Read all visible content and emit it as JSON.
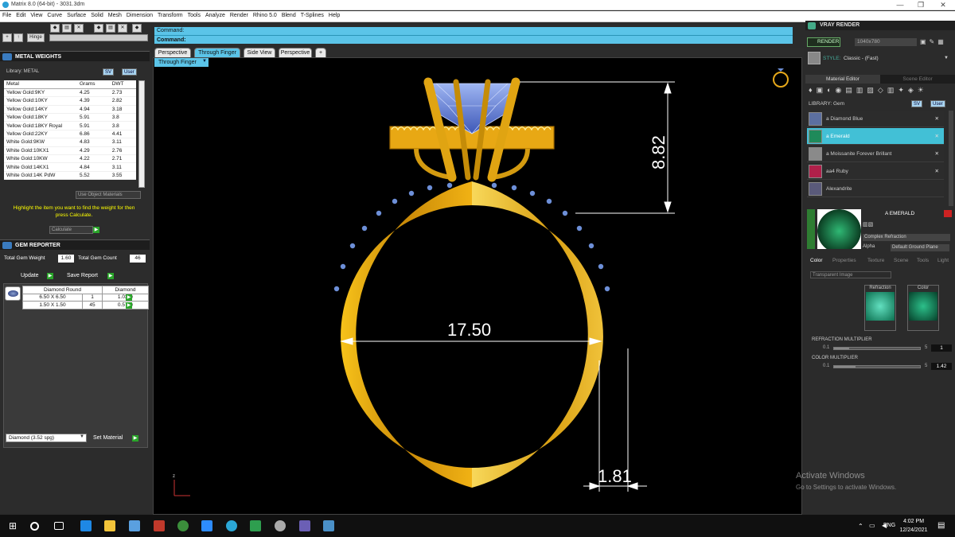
{
  "app": {
    "title": "Matrix 8.0 (64-bit) - 3031.3dm",
    "win_min": "—",
    "win_max": "❐",
    "win_close": "✕"
  },
  "menu": [
    "File",
    "Edit",
    "View",
    "Curve",
    "Surface",
    "Solid",
    "Mesh",
    "Dimension",
    "Transform",
    "Tools",
    "Analyze",
    "Render",
    "Rhino 5.0",
    "Blend",
    "T-Splines",
    "Help"
  ],
  "left_toolbar": {
    "hinge": "Hinge"
  },
  "metal_weights": {
    "title": "METAL WEIGHTS",
    "library_label": "Library: METAL",
    "sv": "SV",
    "user": "User",
    "headers": [
      "Metal",
      "Grams",
      "DWT"
    ],
    "rows": [
      [
        "Yellow Gold:9KY",
        "4.25",
        "2.73"
      ],
      [
        "Yellow Gold:10KY",
        "4.39",
        "2.82"
      ],
      [
        "Yellow Gold:14KY",
        "4.94",
        "3.18"
      ],
      [
        "Yellow Gold:18KY",
        "5.91",
        "3.8"
      ],
      [
        "Yellow Gold:18KY Royal",
        "5.91",
        "3.8"
      ],
      [
        "Yellow Gold:22KY",
        "6.86",
        "4.41"
      ],
      [
        "White Gold:9KW",
        "4.83",
        "3.11"
      ],
      [
        "White Gold:10KX1",
        "4.29",
        "2.76"
      ],
      [
        "White Gold:10KW",
        "4.22",
        "2.71"
      ],
      [
        "White Gold:14KX1",
        "4.84",
        "3.11"
      ],
      [
        "White Gold:14K PdW",
        "5.52",
        "3.55"
      ]
    ],
    "use_object_materials": "Use Object Materials",
    "hint": "Highlight the item you want to find the weight for then press Calculate.",
    "calculate": "Calculate"
  },
  "gem_reporter": {
    "title": "GEM REPORTER",
    "total_weight_label": "Total Gem Weight",
    "total_weight": "1.60",
    "total_count_label": "Total Gem Count",
    "total_count": "46",
    "update": "Update",
    "save_report": "Save Report",
    "headers": [
      "Diamond Round",
      "Diamond"
    ],
    "rows": [
      [
        "6.50 X 6.50",
        "1",
        "1.03tw"
      ],
      [
        "1.50 X 1.50",
        "45",
        "0.57tw"
      ]
    ],
    "material_select": "Diamond   (3.52 spg)",
    "set_material": "Set Material"
  },
  "command": {
    "line1": "Command:",
    "line2": "Command:"
  },
  "tabs": [
    "Perspective",
    "Through Finger",
    "Side View",
    "Perspective",
    "+"
  ],
  "viewport": {
    "label": "Through Finger",
    "dims": {
      "height": "8.82",
      "inner": "17.50",
      "thickness": "1.81"
    },
    "axis_z": "z"
  },
  "vray": {
    "title": "VRAY RENDER",
    "render": "RENDER",
    "resolution": "1040x780",
    "style_label": "STYLE:",
    "style": "Classic - (Fast)",
    "tabs": [
      "Material Editor",
      "Scene Editor"
    ],
    "library": "LIBRARY: Gem",
    "sv": "SV",
    "user": "User",
    "materials": [
      {
        "name": "a Diamond Blue",
        "color": "#5c6fa0"
      },
      {
        "name": "a Emerald",
        "color": "#1f8a5a"
      },
      {
        "name": "a Moissanite Forever Brillant",
        "color": "#8a8a8a"
      },
      {
        "name": "aa4 Ruby",
        "color": "#b0204a"
      },
      {
        "name": "Alexandrite",
        "color": "#5a5a7a"
      }
    ],
    "selected": "A EMERALD",
    "complex": "Complex Refraction",
    "alpha": "Alpha",
    "ground": "Default Ground Plane",
    "subtabs": [
      "Color",
      "Properties",
      "Texture",
      "Scene",
      "Tools",
      "Light"
    ],
    "transparent": "Transparent Image",
    "refraction": "Refraction",
    "color": "Color",
    "refraction_mult_label": "REFRACTION MULTIPLIER",
    "refraction_min": "0.1",
    "refraction_max": "5",
    "refraction_val": "1",
    "color_mult_label": "COLOR MULTIPLIER",
    "color_min": "0.1",
    "color_max": "5",
    "color_val": "1.42",
    "refraction_level": 0.18,
    "color_level": 0.25
  },
  "activate": {
    "line1": "Activate Windows",
    "line2": "Go to Settings to activate Windows."
  },
  "taskbar": {
    "lang": "ENG",
    "time": "4:02 PM",
    "date": "12/24/2021"
  },
  "colors": {
    "accent": "#5bc4e8",
    "gold": "#f0b41e",
    "selected": "#42c0d6"
  }
}
